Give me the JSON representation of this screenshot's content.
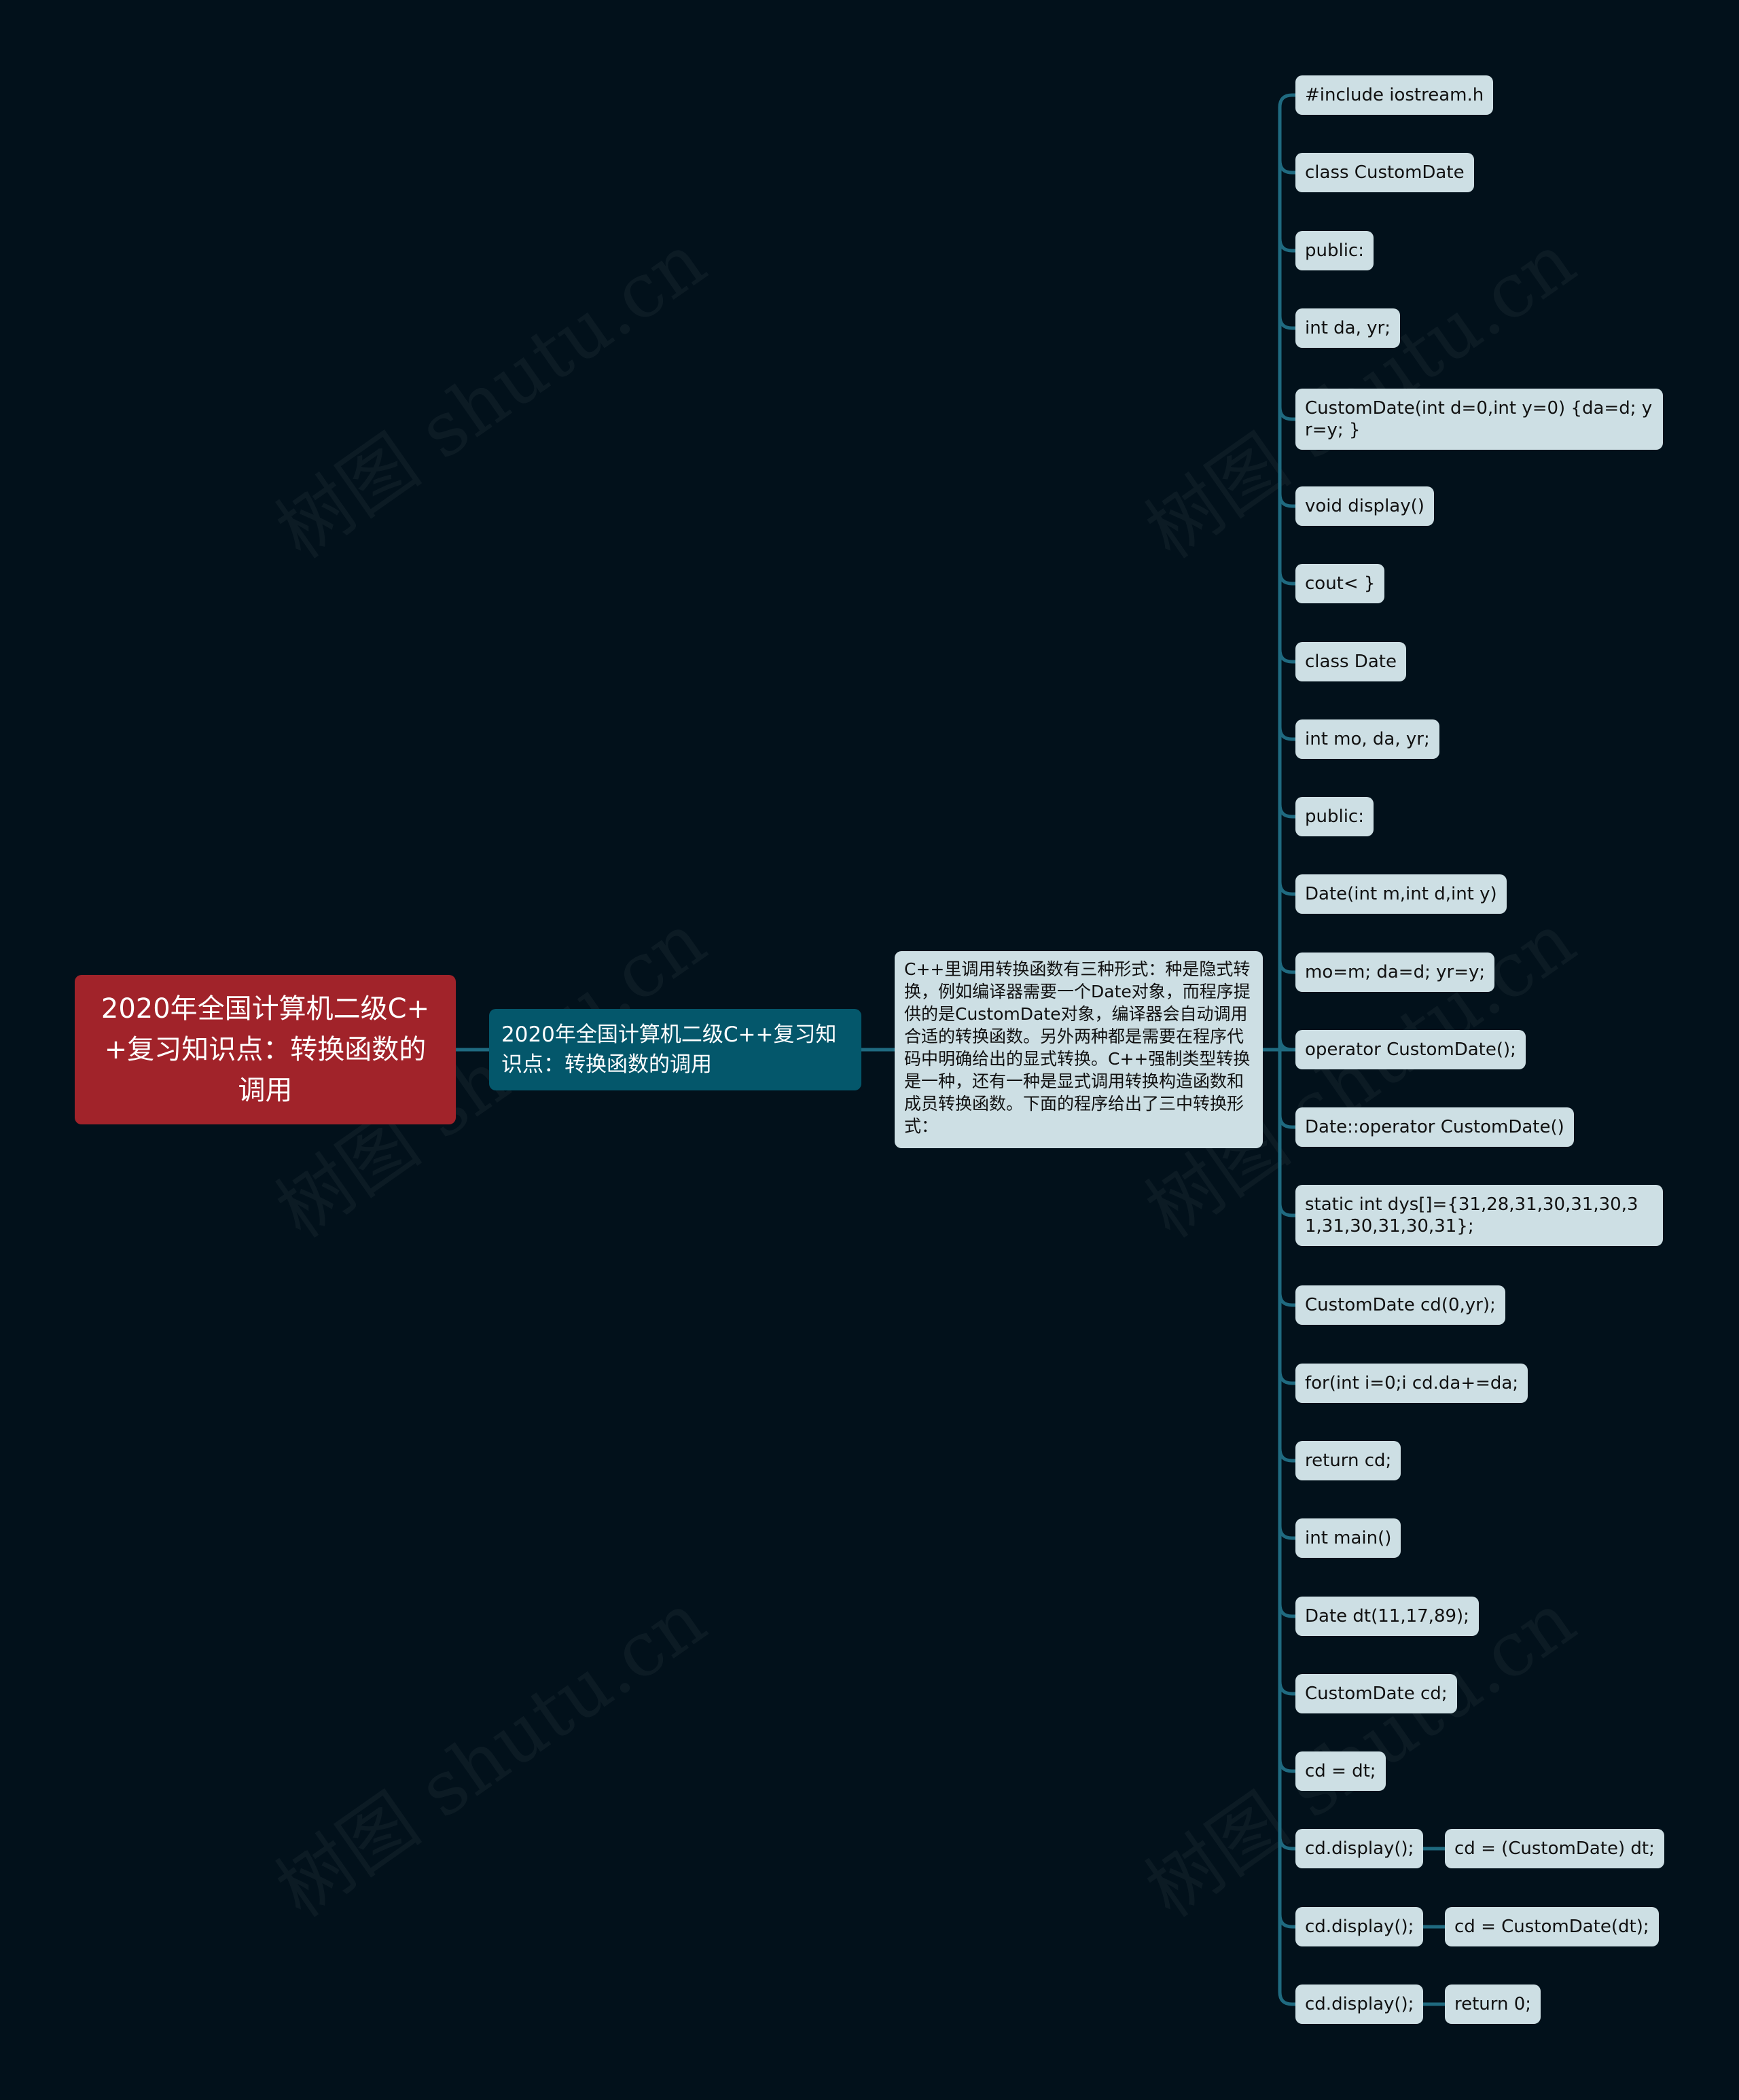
{
  "watermark": "树图 shutu.cn",
  "colors": {
    "background": "#02111b",
    "root": "#a1232a",
    "branch": "#04576b",
    "leaf": "#cddfe4",
    "connector": "#1f6a80"
  },
  "mindmap": {
    "root": {
      "label": "2020年全国计算机二级C++复习知识点：转换函数的调用"
    },
    "branch": {
      "label": "2020年全国计算机二级C++复习知识点：转换函数的调用"
    },
    "description": {
      "label": "C++里调用转换函数有三种形式：种是隐式转换，例如编译器需要一个Date对象，而程序提供的是CustomDate对象，编译器会自动调用合适的转换函数。另外两种都是需要在程序代码中明确给出的显式转换。C++强制类型转换是一种，还有一种是显式调用转换构造函数和成员转换函数。下面的程序给出了三中转换形式："
    },
    "leaves": [
      {
        "label": "#include iostream.h"
      },
      {
        "label": "class CustomDate"
      },
      {
        "label": "public:"
      },
      {
        "label": "int da, yr;"
      },
      {
        "label": "CustomDate(int d=0,int y=0) {da=d; yr=y; }"
      },
      {
        "label": "void display()"
      },
      {
        "label": "cout< }"
      },
      {
        "label": "class Date"
      },
      {
        "label": "int mo, da, yr;"
      },
      {
        "label": "public:"
      },
      {
        "label": "Date(int m,int d,int y)"
      },
      {
        "label": "mo=m; da=d; yr=y;"
      },
      {
        "label": "operator CustomDate();"
      },
      {
        "label": "Date::operator CustomDate()"
      },
      {
        "label": "static int dys[]={31,28,31,30,31,30,31,31,30,31,30,31};"
      },
      {
        "label": "CustomDate cd(0,yr);"
      },
      {
        "label": "for(int i=0;i cd.da+=da;"
      },
      {
        "label": "return cd;"
      },
      {
        "label": "int main()"
      },
      {
        "label": "Date dt(11,17,89);"
      },
      {
        "label": "CustomDate cd;"
      },
      {
        "label": "cd = dt;"
      },
      {
        "label": "cd.display();",
        "child": "cd = (CustomDate) dt;"
      },
      {
        "label": "cd.display();",
        "child": "cd = CustomDate(dt);"
      },
      {
        "label": "cd.display();",
        "child": "return 0;"
      }
    ]
  }
}
